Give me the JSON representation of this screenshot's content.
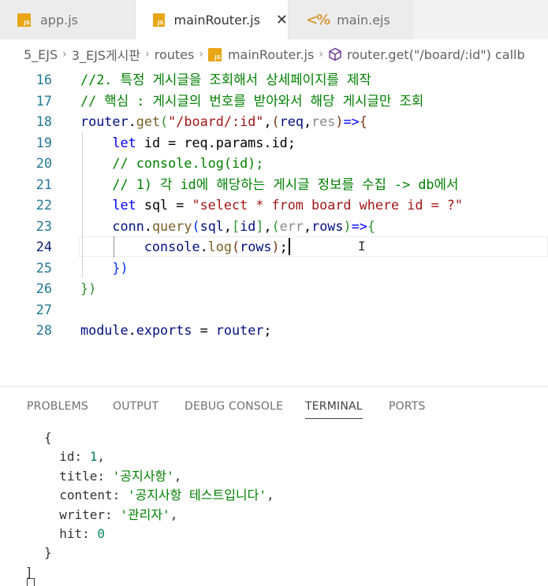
{
  "tabs": [
    {
      "label": "app.js",
      "icon": "js-file-icon"
    },
    {
      "label": "mainRouter.js",
      "icon": "js-file-icon",
      "active": true
    },
    {
      "label": "main.ejs",
      "icon": "ejs-file-icon"
    }
  ],
  "breadcrumb": {
    "items": [
      "5_EJS",
      "3_EJS게시판",
      "routes",
      "mainRouter.js",
      "router.get(\"/board/:id\") callb"
    ]
  },
  "editor": {
    "active_line": 24,
    "lines": [
      {
        "n": "16",
        "tokens": [
          {
            "t": "//2. 특정 게시글을 조회해서 상세페이지를 제작",
            "c": "c-com"
          }
        ]
      },
      {
        "n": "17",
        "tokens": [
          {
            "t": "// 핵심 : 게시글의 번호를 받아와서 해당 게시글만 조회",
            "c": "c-com"
          }
        ]
      },
      {
        "n": "18",
        "tokens": [
          {
            "t": "router",
            "c": "c-var"
          },
          {
            "t": ".",
            "c": "c-txt"
          },
          {
            "t": "get",
            "c": "c-fn"
          },
          {
            "t": "(",
            "c": "c-br1"
          },
          {
            "t": "\"/board/:id\"",
            "c": "c-str"
          },
          {
            "t": ",",
            "c": "c-txt"
          },
          {
            "t": "(",
            "c": "c-br2"
          },
          {
            "t": "req",
            "c": "c-var"
          },
          {
            "t": ",",
            "c": "c-txt"
          },
          {
            "t": "res",
            "c": "c-unused"
          },
          {
            "t": ")",
            "c": "c-br2"
          },
          {
            "t": "=>",
            "c": "c-kw"
          },
          {
            "t": "{",
            "c": "c-br2"
          }
        ]
      },
      {
        "n": "19",
        "tokens": [
          {
            "t": "    ",
            "c": "c-txt"
          },
          {
            "t": "let",
            "c": "c-kw"
          },
          {
            "t": " id = req.params.id;",
            "c": "c-txt"
          }
        ]
      },
      {
        "n": "20",
        "tokens": [
          {
            "t": "    ",
            "c": "c-txt"
          },
          {
            "t": "// console.log(id);",
            "c": "c-com"
          }
        ]
      },
      {
        "n": "21",
        "tokens": [
          {
            "t": "    ",
            "c": "c-txt"
          },
          {
            "t": "// 1) 각 id에 해당하는 게시글 정보를 수집 -> db에서",
            "c": "c-com"
          }
        ]
      },
      {
        "n": "22",
        "tokens": [
          {
            "t": "    ",
            "c": "c-txt"
          },
          {
            "t": "let",
            "c": "c-kw"
          },
          {
            "t": " sql = ",
            "c": "c-txt"
          },
          {
            "t": "\"select * from board where id = ?\"",
            "c": "c-str"
          }
        ]
      },
      {
        "n": "23",
        "tokens": [
          {
            "t": "    ",
            "c": "c-txt"
          },
          {
            "t": "conn",
            "c": "c-var"
          },
          {
            "t": ".",
            "c": "c-txt"
          },
          {
            "t": "query",
            "c": "c-fn"
          },
          {
            "t": "(",
            "c": "c-br3"
          },
          {
            "t": "sql",
            "c": "c-var"
          },
          {
            "t": ",",
            "c": "c-txt"
          },
          {
            "t": "[",
            "c": "c-br1"
          },
          {
            "t": "id",
            "c": "c-var"
          },
          {
            "t": "]",
            "c": "c-br1"
          },
          {
            "t": ",",
            "c": "c-txt"
          },
          {
            "t": "(",
            "c": "c-br1"
          },
          {
            "t": "err",
            "c": "c-unused"
          },
          {
            "t": ",",
            "c": "c-txt"
          },
          {
            "t": "rows",
            "c": "c-var"
          },
          {
            "t": ")",
            "c": "c-br1"
          },
          {
            "t": "=>",
            "c": "c-kw"
          },
          {
            "t": "{",
            "c": "c-br1"
          }
        ]
      },
      {
        "n": "24",
        "tokens": [
          {
            "t": "        ",
            "c": "c-txt"
          },
          {
            "t": "console",
            "c": "c-var"
          },
          {
            "t": ".",
            "c": "c-txt"
          },
          {
            "t": "log",
            "c": "c-fn"
          },
          {
            "t": "(",
            "c": "c-br2"
          },
          {
            "t": "rows",
            "c": "c-var"
          },
          {
            "t": ")",
            "c": "c-br2"
          },
          {
            "t": ";",
            "c": "c-txt"
          }
        ]
      },
      {
        "n": "25",
        "tokens": [
          {
            "t": "    ",
            "c": "c-txt"
          },
          {
            "t": "})",
            "c": "c-br3"
          }
        ]
      },
      {
        "n": "26",
        "tokens": [
          {
            "t": "})",
            "c": "c-br1"
          }
        ]
      },
      {
        "n": "27",
        "tokens": []
      },
      {
        "n": "28",
        "tokens": [
          {
            "t": "module",
            "c": "c-var"
          },
          {
            "t": ".",
            "c": "c-txt"
          },
          {
            "t": "exports",
            "c": "c-var"
          },
          {
            "t": " = ",
            "c": "c-txt"
          },
          {
            "t": "router",
            "c": "c-var"
          },
          {
            "t": ";",
            "c": "c-txt"
          }
        ]
      }
    ]
  },
  "panel": {
    "tabs": [
      "PROBLEMS",
      "OUTPUT",
      "DEBUG CONSOLE",
      "TERMINAL",
      "PORTS"
    ],
    "active_tab": "TERMINAL"
  },
  "terminal": {
    "lines": [
      {
        "indent": 2,
        "tokens": [
          {
            "t": "{",
            "c": ""
          }
        ]
      },
      {
        "indent": 4,
        "tokens": [
          {
            "t": "id: ",
            "c": ""
          },
          {
            "t": "1",
            "c": "t-num"
          },
          {
            "t": ",",
            "c": ""
          }
        ]
      },
      {
        "indent": 4,
        "tokens": [
          {
            "t": "title: ",
            "c": ""
          },
          {
            "t": "'공지사항'",
            "c": "t-str"
          },
          {
            "t": ",",
            "c": ""
          }
        ]
      },
      {
        "indent": 4,
        "tokens": [
          {
            "t": "content: ",
            "c": ""
          },
          {
            "t": "'공지사항 테스트입니다'",
            "c": "t-str"
          },
          {
            "t": ",",
            "c": ""
          }
        ]
      },
      {
        "indent": 4,
        "tokens": [
          {
            "t": "writer: ",
            "c": ""
          },
          {
            "t": "'관리자'",
            "c": "t-str"
          },
          {
            "t": ",",
            "c": ""
          }
        ]
      },
      {
        "indent": 4,
        "tokens": [
          {
            "t": "hit: ",
            "c": ""
          },
          {
            "t": "0",
            "c": "t-num"
          }
        ]
      },
      {
        "indent": 2,
        "tokens": [
          {
            "t": "}",
            "c": ""
          }
        ]
      },
      {
        "indent": 0,
        "tokens": [
          {
            "t": "]",
            "c": ""
          }
        ]
      }
    ]
  }
}
